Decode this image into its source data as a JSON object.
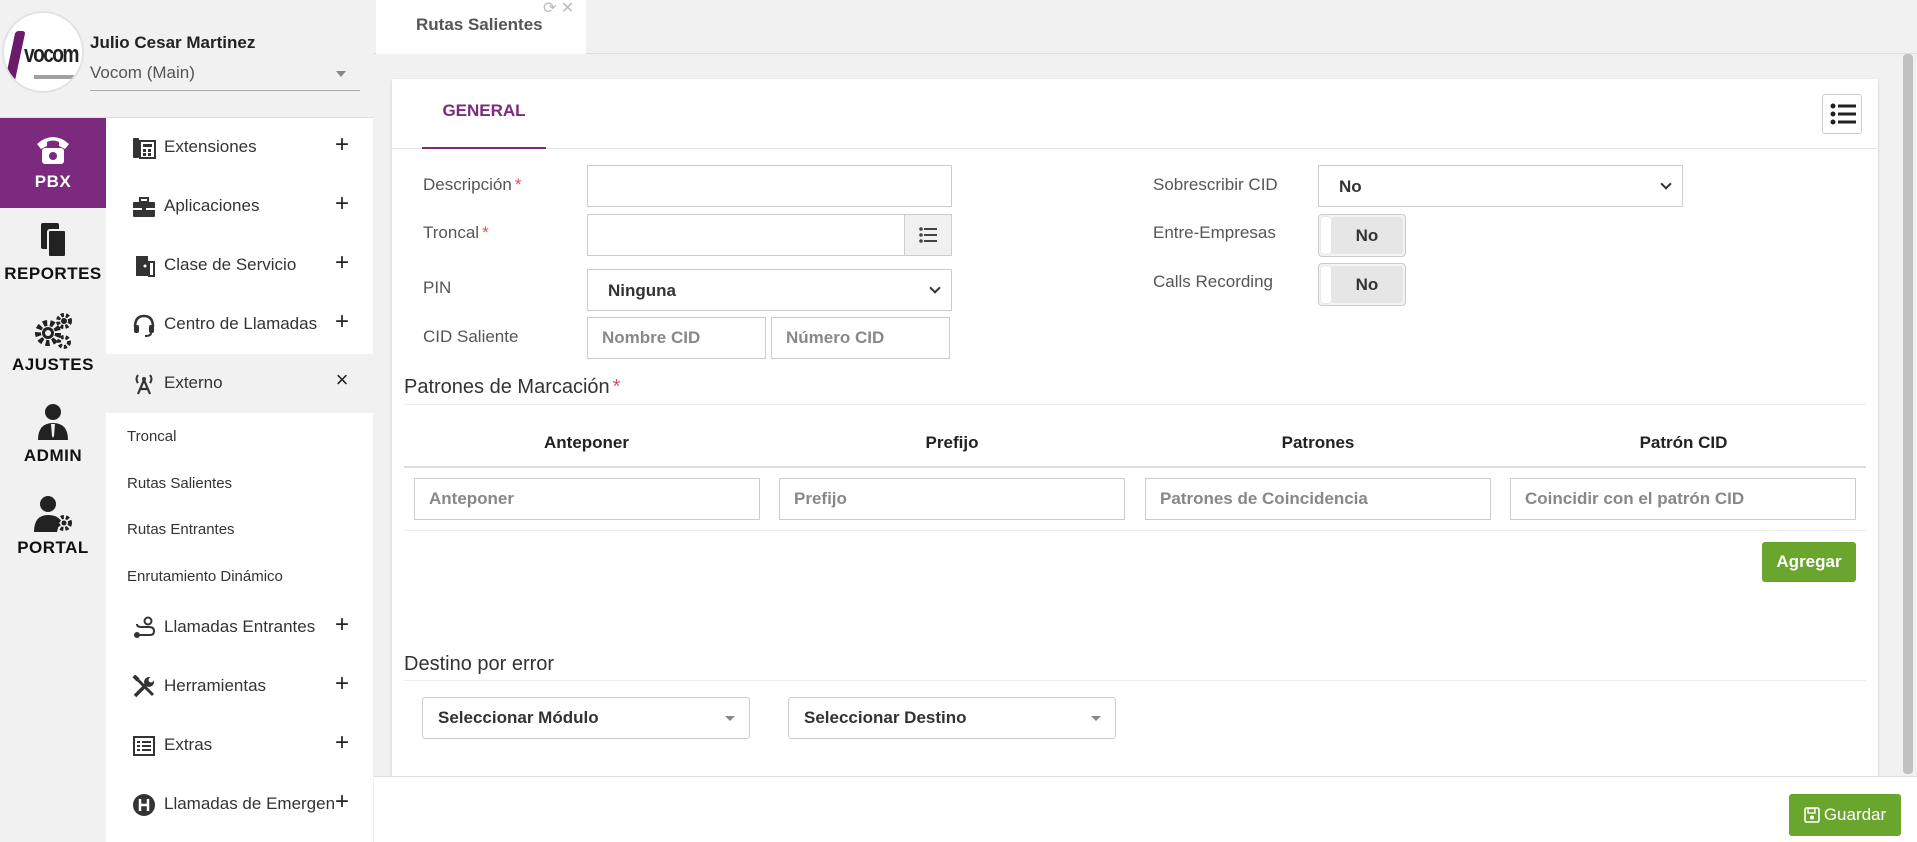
{
  "user": {
    "name": "Julio Cesar Martinez",
    "tenant": "Vocom (Main)",
    "logo_text": "vocom"
  },
  "rail": [
    {
      "label": "PBX",
      "icon": "phone-icon"
    },
    {
      "label": "REPORTES",
      "icon": "documents-icon"
    },
    {
      "label": "AJUSTES",
      "icon": "gears-icon"
    },
    {
      "label": "ADMIN",
      "icon": "admin-user-icon"
    },
    {
      "label": "PORTAL",
      "icon": "user-gear-icon"
    }
  ],
  "menu": {
    "extensiones": "Extensiones",
    "aplicaciones": "Aplicaciones",
    "clase_servicio": "Clase de Servicio",
    "centro_llamadas": "Centro de Llamadas",
    "externo": "Externo",
    "externo_items": [
      "Troncal",
      "Rutas Salientes",
      "Rutas Entrantes",
      "Enrutamiento Dinámico"
    ],
    "llamadas_entrantes": "Llamadas Entrantes",
    "herramientas": "Herramientas",
    "extras": "Extras",
    "llamadas_emergencia": "Llamadas de Emergen...",
    "plus": "+",
    "close": "×"
  },
  "tabs": {
    "active": "Rutas Salientes"
  },
  "form": {
    "tab_general": "GENERAL",
    "descripcion_label": "Descripción",
    "troncal_label": "Troncal",
    "pin_label": "PIN",
    "pin_value": "Ninguna",
    "cid_saliente_label": "CID Saliente",
    "nombre_cid_placeholder": "Nombre CID",
    "numero_cid_placeholder": "Número CID",
    "sobrescribir_label": "Sobrescribir CID",
    "sobrescribir_value": "No",
    "entre_empresas_label": "Entre-Empresas",
    "entre_empresas_value": "No",
    "calls_recording_label": "Calls Recording",
    "calls_recording_value": "No",
    "required_mark": "*"
  },
  "patterns": {
    "title": "Patrones de Marcación",
    "columns": [
      "Anteponer",
      "Prefijo",
      "Patrones",
      "Patrón CID"
    ],
    "placeholders": [
      "Anteponer",
      "Prefijo",
      "Patrones de Coincidencia",
      "Coincidir con el patrón CID"
    ],
    "add_label": "Agregar"
  },
  "failover": {
    "title": "Destino por error",
    "module_placeholder": "Seleccionar Módulo",
    "destination_placeholder": "Seleccionar Destino"
  },
  "footer": {
    "save_label": "Guardar"
  },
  "colors": {
    "brand": "#7b2a7e",
    "success": "#6aa52e",
    "required": "#d9534f"
  }
}
